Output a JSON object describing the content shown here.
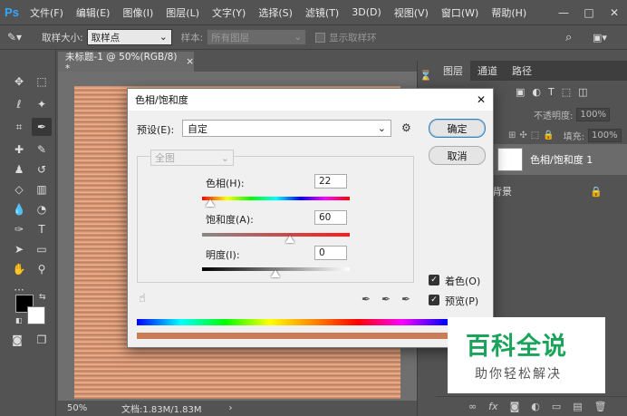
{
  "app": {
    "logo": "Ps"
  },
  "menu": [
    "文件(F)",
    "编辑(E)",
    "图像(I)",
    "图层(L)",
    "文字(Y)",
    "选择(S)",
    "滤镜(T)",
    "3D(D)",
    "视图(V)",
    "窗口(W)",
    "帮助(H)"
  ],
  "window_controls": {
    "minimize": "—",
    "maximize": "□",
    "close": "✕"
  },
  "options": {
    "sample_size_label": "取样大小:",
    "sample_size_value": "取样点",
    "sample_label": "样本:",
    "sample_value": "所有图层",
    "show_ring_label": "显示取样环"
  },
  "document": {
    "tab_title": "未标题-1 @ 50%(RGB/8) *",
    "tab_close": "×",
    "zoom": "50%",
    "doc_info": "文档:1.83M/1.83M",
    "arrow": "›"
  },
  "panel": {
    "tabs": [
      "图层",
      "通道",
      "路径"
    ],
    "opacity_label": "不透明度:",
    "opacity_value": "100%",
    "fill_label": "填充:",
    "fill_value": "100%",
    "layers": [
      {
        "name": "色相/饱和度 1"
      },
      {
        "name": "背景"
      }
    ]
  },
  "dialog": {
    "title": "色相/饱和度",
    "close": "✕",
    "preset_label": "预设(E):",
    "preset_value": "自定",
    "channel_value": "全图",
    "ok_label": "确定",
    "cancel_label": "取消",
    "hue_label": "色相(H):",
    "hue_value": "22",
    "saturation_label": "饱和度(A):",
    "saturation_value": "60",
    "lightness_label": "明度(I):",
    "lightness_value": "0",
    "colorize_label": "着色(O)",
    "colorize_checked": true,
    "preview_label": "预览(P)",
    "preview_checked": true
  },
  "watermark": {
    "title": "百科全说",
    "subtitle": "助你轻松解决",
    "color": "#1aa35a"
  }
}
